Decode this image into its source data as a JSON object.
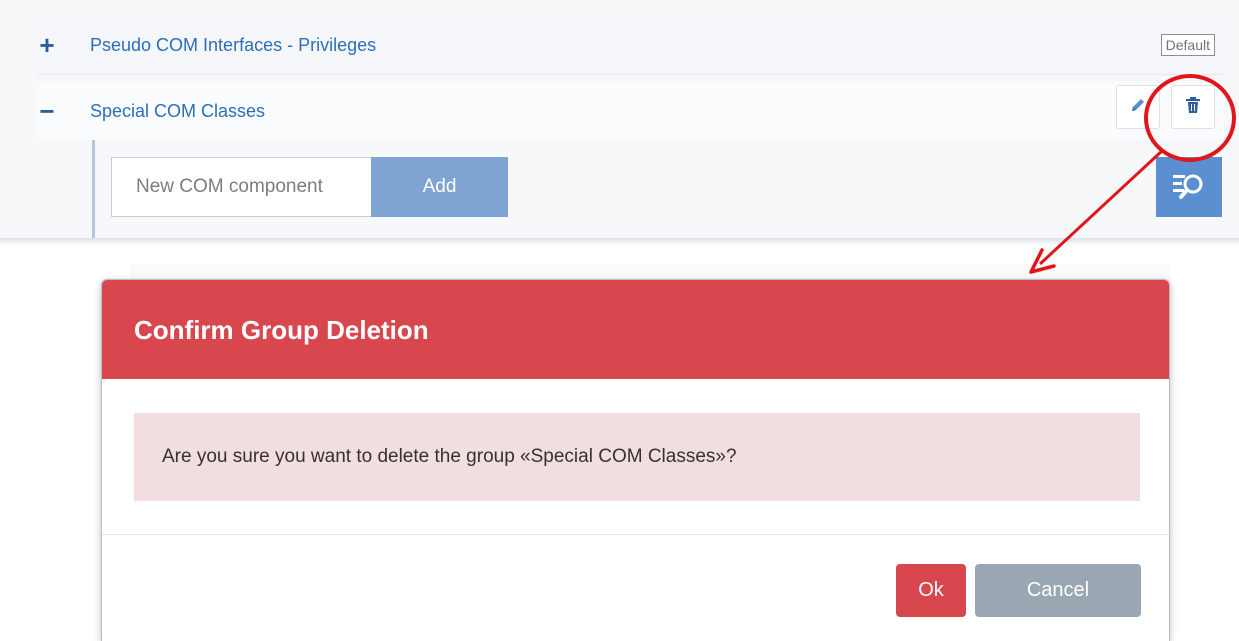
{
  "groups": [
    {
      "toggle": "+",
      "label": "Pseudo COM Interfaces - Privileges",
      "badge": "Default"
    },
    {
      "toggle": "−",
      "label": "Special COM Classes"
    }
  ],
  "component_input": {
    "placeholder": "New COM component",
    "value": ""
  },
  "add_button": "Add",
  "icons": {
    "edit": "pencil-icon",
    "delete": "trash-icon",
    "search_list": "list-search-icon"
  },
  "annotation": {
    "color": "#e0161b",
    "type": "circle-and-arrow"
  },
  "dialog": {
    "title": "Confirm Group Deletion",
    "message": "Are you sure you want to delete the group «Special COM Classes»?",
    "ok_label": "Ok",
    "cancel_label": "Cancel"
  },
  "colors": {
    "header_red": "#d9474e",
    "alert_bg": "#f2dede",
    "link_blue": "#2d6fb5",
    "add_blue": "#7fa3d3",
    "cancel_gray": "#9aa6b2"
  }
}
